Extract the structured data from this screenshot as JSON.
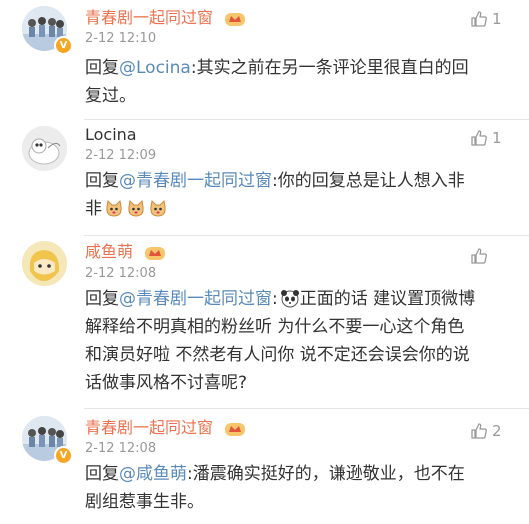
{
  "comments": [
    {
      "username": "青春剧一起同过窗",
      "time": "2-12 12:10",
      "reply_prefix": "回复",
      "mention": "@Locina",
      "text": ":其实之前在另一条评论里很直白的回",
      "text2": "复过。",
      "likes": "1"
    },
    {
      "username": "Locina",
      "time": "2-12 12:09",
      "reply_prefix": "回复",
      "mention": "@青春剧一起同过窗",
      "text": ":你的回复总是让人想入非",
      "text2": "非",
      "likes": "1"
    },
    {
      "username": "咸鱼萌",
      "time": "2-12 12:08",
      "reply_prefix": "回复",
      "mention": "@青春剧一起同过窗",
      "text": "正面的话 建议置顶微博",
      "text2": "解释给不明真相的粉丝听 为什么不要一心这个角色",
      "text3": "和演员好啦 不然老有人问你 说不定还会误会你的说",
      "text4": "话做事风格不讨喜呢?",
      "likes": ""
    },
    {
      "username": "青春剧一起同过窗",
      "time": "2-12 12:08",
      "reply_prefix": "回复",
      "mention": "@咸鱼萌",
      "text": ":潘震确实挺好的，谦逊敬业，也不在",
      "text2": "剧组惹事生非。",
      "likes": "2"
    }
  ],
  "colors": {
    "username": "#eb7350",
    "mention": "#5a8ab9",
    "meta": "#999999"
  },
  "icons": [
    "thumb-up-icon",
    "verified-badge-icon",
    "member-crown-badge-icon",
    "cat-emoji-icon",
    "panda-emoji-icon"
  ]
}
